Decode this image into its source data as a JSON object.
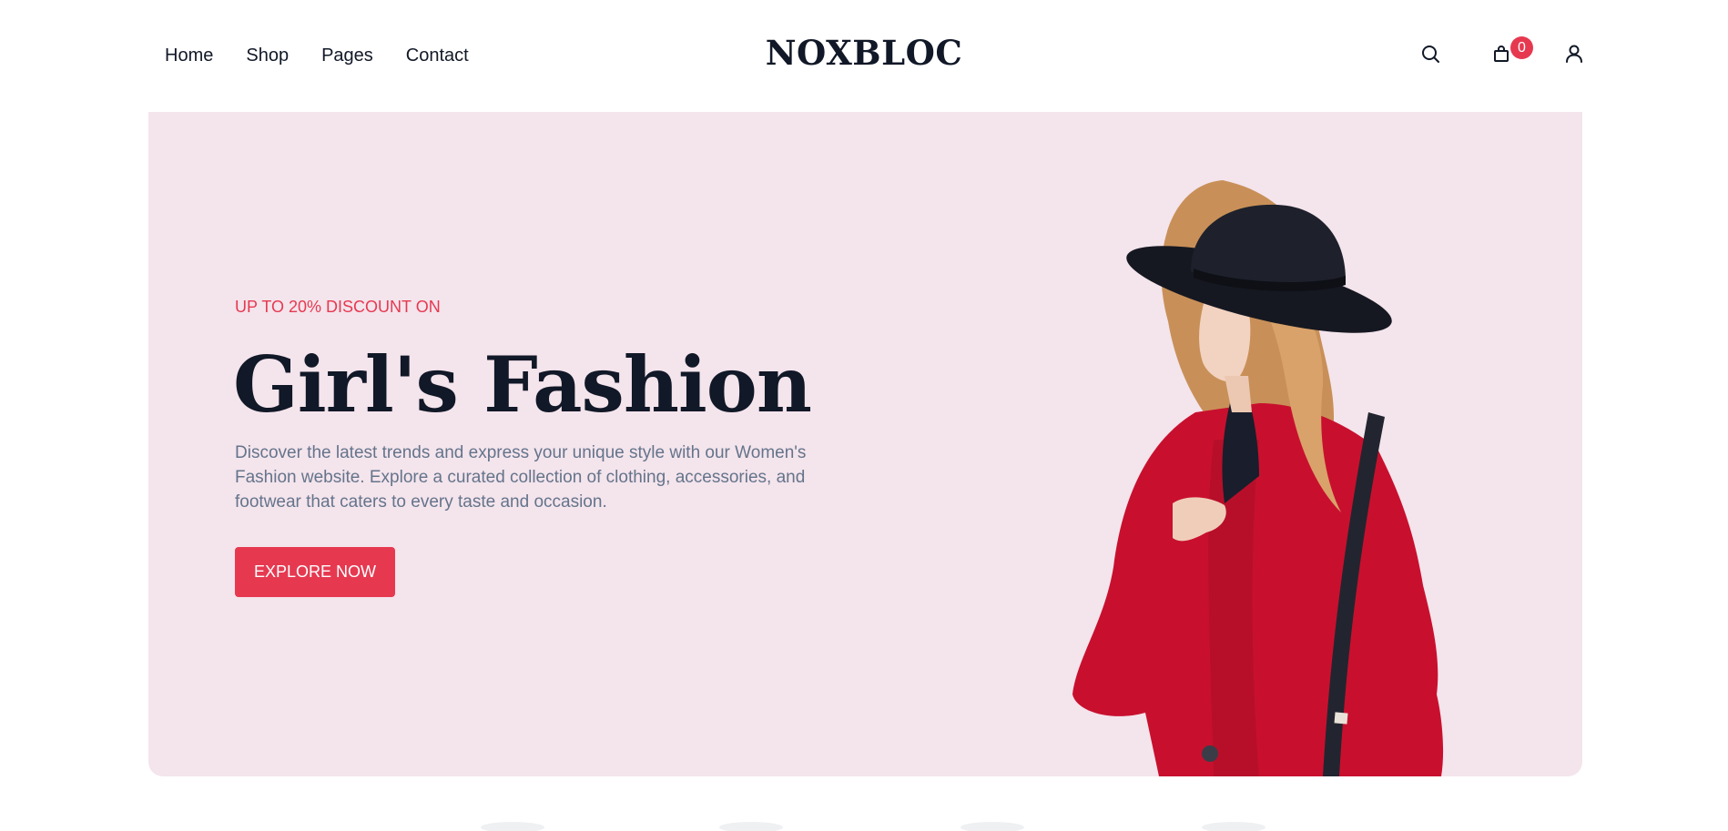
{
  "nav": {
    "items": [
      {
        "label": "Home"
      },
      {
        "label": "Shop"
      },
      {
        "label": "Pages"
      },
      {
        "label": "Contact"
      }
    ]
  },
  "brand": {
    "logo": "NOXBLOC"
  },
  "header_icons": {
    "search": "search-icon",
    "cart": "shopping-bag-icon",
    "cart_count": "0",
    "account": "user-icon"
  },
  "hero": {
    "eyebrow": "UP TO 20% DISCOUNT ON",
    "title": "Girl's Fashion",
    "description": "Discover the latest trends and express your unique style with our Women's Fashion website. Explore a curated collection of clothing, accessories, and footwear that caters to every taste and occasion.",
    "cta_label": "EXPLORE NOW"
  },
  "colors": {
    "accent": "#e63950",
    "hero_background": "#f4e4ec",
    "text_dark": "#111827",
    "text_muted": "#64748b"
  }
}
